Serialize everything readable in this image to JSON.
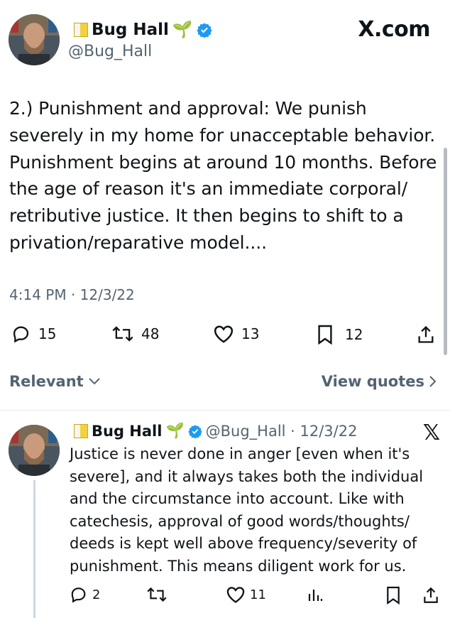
{
  "tweet": {
    "name": "Bug Hall",
    "name_emoji": "🌱",
    "handle": "@Bug_Hall",
    "site": "X.com",
    "text": "2.) Punishment and approval: We punish severely in my home for unacceptable behavior. Punishment begins at around 10 months. Before the age of reason it's an immediate corporal/ retributive justice. It then begins to shift to a privation/reparative model....",
    "timestamp": "4:14 PM · 12/3/22",
    "stats": {
      "replies": "15",
      "reposts": "48",
      "likes": "13",
      "bookmarks": "12"
    }
  },
  "tabs": {
    "relevant": "Relevant",
    "view_quotes": "View quotes"
  },
  "reply": {
    "name": "Bug Hall",
    "name_emoji": "🌱",
    "handle_date": "@Bug_Hall · 12/3/22",
    "text": "Justice is never done in anger [even when it's severe], and it always takes both the individual and the circumstance into account. Like with catechesis, approval of good words/thoughts/ deeds is kept well above frequency/severity of punishment. This means diligent work for us.",
    "stats": {
      "replies": "2",
      "reposts": "",
      "likes": "11"
    }
  },
  "colors": {
    "verified": "#1d9bf0",
    "text": "#0f1419",
    "muted": "#536471"
  },
  "icons": [
    "reply-icon",
    "repost-icon",
    "like-icon",
    "bookmark-icon",
    "share-icon",
    "views-icon",
    "verified-icon",
    "x-logo-icon",
    "chevron-down-icon",
    "chevron-right-icon"
  ]
}
